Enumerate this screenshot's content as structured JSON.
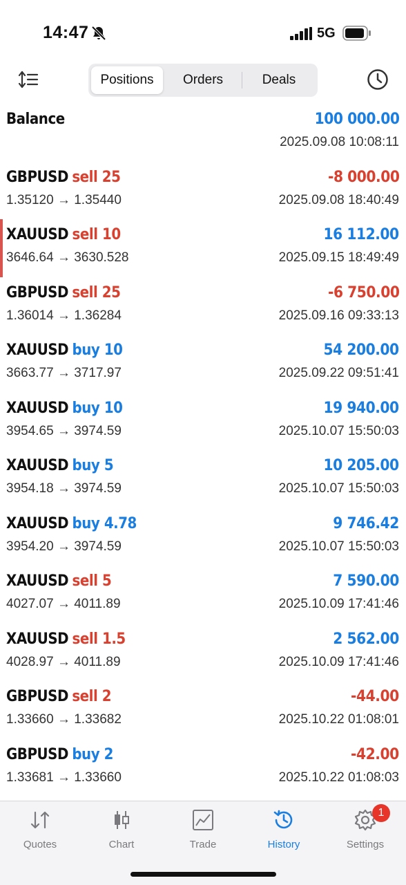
{
  "status_bar": {
    "time": "14:47",
    "network": "5G",
    "icons": [
      "bell-slash-icon",
      "signal-icon",
      "battery-icon"
    ]
  },
  "toolbar": {
    "tabs": [
      {
        "label": "Positions",
        "active": true
      },
      {
        "label": "Orders",
        "active": false
      },
      {
        "label": "Deals",
        "active": false
      }
    ],
    "icons": [
      "sort-icon",
      "clock-icon"
    ]
  },
  "balance": {
    "label": "Balance",
    "amount": "100 000.00",
    "time": "2025.09.08 10:08:11"
  },
  "rows": [
    {
      "symbol": "GBPUSD",
      "direction": "sell",
      "volume": "25",
      "prices": "1.35120 → 1.35440",
      "profit": "-8 000.00",
      "time": "2025.09.08 18:40:49"
    },
    {
      "symbol": "XAUUSD",
      "direction": "sell",
      "volume": "10",
      "prices": "3646.64 → 3630.528",
      "profit": "16 112.00",
      "time": "2025.09.15 18:49:49"
    },
    {
      "symbol": "GBPUSD",
      "direction": "sell",
      "volume": "25",
      "prices": "1.36014 → 1.36284",
      "profit": "-6 750.00",
      "time": "2025.09.16 09:33:13"
    },
    {
      "symbol": "XAUUSD",
      "direction": "buy",
      "volume": "10",
      "prices": "3663.77 → 3717.97",
      "profit": "54 200.00",
      "time": "2025.09.22 09:51:41"
    },
    {
      "symbol": "XAUUSD",
      "direction": "buy",
      "volume": "10",
      "prices": "3954.65 → 3974.59",
      "profit": "19 940.00",
      "time": "2025.10.07 15:50:03"
    },
    {
      "symbol": "XAUUSD",
      "direction": "buy",
      "volume": "5",
      "prices": "3954.18 → 3974.59",
      "profit": "10 205.00",
      "time": "2025.10.07 15:50:03"
    },
    {
      "symbol": "XAUUSD",
      "direction": "buy",
      "volume": "4.78",
      "prices": "3954.20 → 3974.59",
      "profit": "9 746.42",
      "time": "2025.10.07 15:50:03"
    },
    {
      "symbol": "XAUUSD",
      "direction": "sell",
      "volume": "5",
      "prices": "4027.07 → 4011.89",
      "profit": "7 590.00",
      "time": "2025.10.09 17:41:46"
    },
    {
      "symbol": "XAUUSD",
      "direction": "sell",
      "volume": "1.5",
      "prices": "4028.97 → 4011.89",
      "profit": "2 562.00",
      "time": "2025.10.09 17:41:46"
    },
    {
      "symbol": "GBPUSD",
      "direction": "sell",
      "volume": "2",
      "prices": "1.33660 → 1.33682",
      "profit": "-44.00",
      "time": "2025.10.22 01:08:01"
    },
    {
      "symbol": "GBPUSD",
      "direction": "buy",
      "volume": "2",
      "prices": "1.33681 → 1.33660",
      "profit": "-42.00",
      "time": "2025.10.22 01:08:03"
    }
  ],
  "tabbar": {
    "tabs": [
      {
        "label": "Quotes",
        "icon": "quotes-icon",
        "active": false
      },
      {
        "label": "Chart",
        "icon": "chart-icon",
        "active": false
      },
      {
        "label": "Trade",
        "icon": "trade-icon",
        "active": false
      },
      {
        "label": "History",
        "icon": "history-icon",
        "active": true
      },
      {
        "label": "Settings",
        "icon": "settings-icon",
        "active": false
      }
    ],
    "settings_badge": "1"
  },
  "colors": {
    "positive": "#1a7ee0",
    "negative": "#d8402f",
    "accent": "#1a7ee0"
  }
}
